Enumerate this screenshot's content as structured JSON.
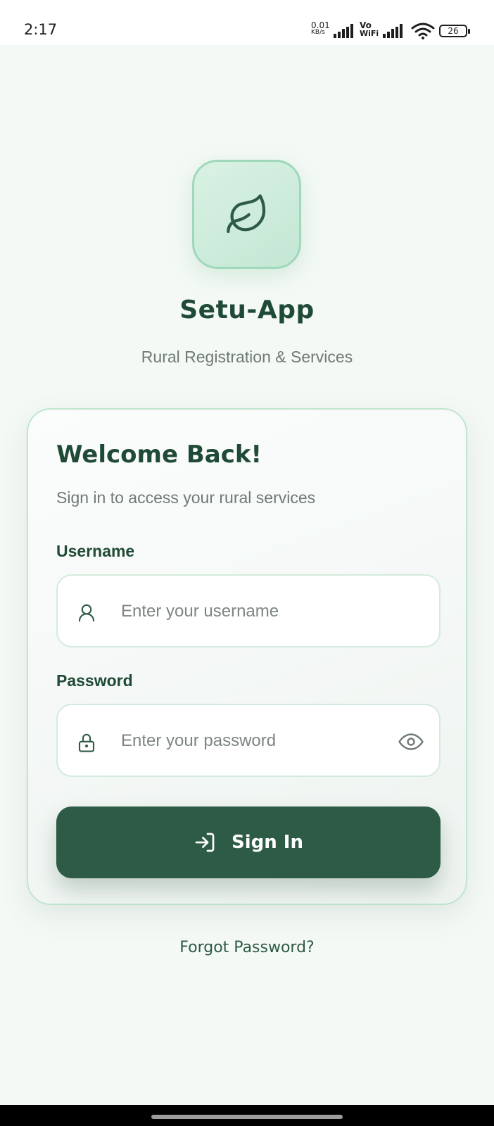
{
  "status_bar": {
    "time": "2:17",
    "net_speed_value": "0.01",
    "net_speed_unit": "KB/s",
    "vo_label": "Vo",
    "wifi_label": "WiFi",
    "battery": "26"
  },
  "app": {
    "title": "Setu-App",
    "subtitle": "Rural Registration & Services",
    "logo_icon": "leaf-icon"
  },
  "login": {
    "heading": "Welcome Back!",
    "subheading": "Sign in to access your rural services",
    "username": {
      "label": "Username",
      "placeholder": "Enter your username",
      "value": "",
      "icon": "user-icon"
    },
    "password": {
      "label": "Password",
      "placeholder": "Enter your password",
      "value": "",
      "icon": "lock-icon",
      "toggle_icon": "eye-icon"
    },
    "submit_label": "Sign In",
    "submit_icon": "login-arrow-icon",
    "forgot_label": "Forgot Password?"
  },
  "colors": {
    "background": "#f4f9f5",
    "primary": "#2e5b45",
    "heading": "#1f4a36",
    "muted": "#6f7a75",
    "accent_border": "#bfe5cf"
  }
}
